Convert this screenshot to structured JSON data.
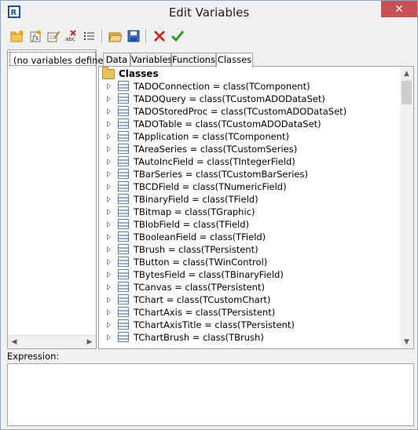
{
  "window": {
    "title": "Edit Variables",
    "close_label": "✕",
    "app_icon": "fastreport-icon"
  },
  "toolbar": {
    "buttons": [
      {
        "name": "new-category-button",
        "icon": "new-folder-icon"
      },
      {
        "name": "new-variable-button",
        "icon": "new-variable-icon"
      },
      {
        "name": "edit-button",
        "icon": "edit-icon"
      },
      {
        "name": "delete-button",
        "icon": "delete-abc-icon"
      },
      {
        "name": "list-button",
        "icon": "list-icon"
      },
      {
        "name": "open-button",
        "icon": "open-folder-icon"
      },
      {
        "name": "save-button",
        "icon": "save-disk-icon"
      },
      {
        "name": "cancel-button",
        "icon": "red-x-icon"
      },
      {
        "name": "ok-button",
        "icon": "green-check-icon"
      }
    ]
  },
  "left_panel": {
    "item": "(no variables defined)"
  },
  "tabs": [
    {
      "label": "Data"
    },
    {
      "label": "Variables"
    },
    {
      "label": "Functions"
    },
    {
      "label": "Classes"
    }
  ],
  "tree": {
    "root": "Classes",
    "items": [
      "TADOConnection = class(TComponent)",
      "TADOQuery = class(TCustomADODataSet)",
      "TADOStoredProc = class(TCustomADODataSet)",
      "TADOTable = class(TCustomADODataSet)",
      "TApplication = class(TComponent)",
      "TAreaSeries = class(TCustomSeries)",
      "TAutoIncField = class(TIntegerField)",
      "TBarSeries = class(TCustomBarSeries)",
      "TBCDField = class(TNumericField)",
      "TBinaryField = class(TField)",
      "TBitmap = class(TGraphic)",
      "TBlobField = class(TField)",
      "TBooleanField = class(TField)",
      "TBrush = class(TPersistent)",
      "TButton = class(TWinControl)",
      "TBytesField = class(TBinaryField)",
      "TCanvas = class(TPersistent)",
      "TChart = class(TCustomChart)",
      "TChartAxis = class(TPersistent)",
      "TChartAxisTitle = class(TPersistent)",
      "TChartBrush = class(TBrush)"
    ]
  },
  "expression": {
    "label": "Expression:",
    "value": ""
  }
}
